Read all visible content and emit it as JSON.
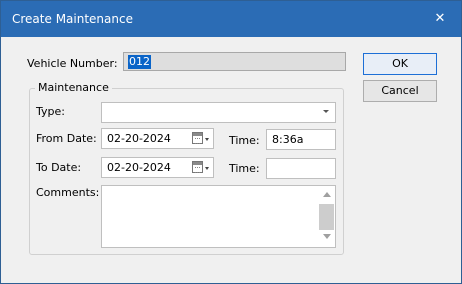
{
  "window": {
    "title": "Create Maintenance",
    "close_glyph": "✕"
  },
  "vehicle": {
    "label": "Vehicle Number:",
    "value": "012"
  },
  "buttons": {
    "ok": "OK",
    "cancel": "Cancel"
  },
  "maintenance": {
    "caption": "Maintenance",
    "type_label": "Type:",
    "type_value": "",
    "from_date_label": "From Date:",
    "from_date_value": "02-20-2024",
    "from_time_label": "Time:",
    "from_time_value": "8:36a",
    "to_date_label": "To Date:",
    "to_date_value": "02-20-2024",
    "to_time_label": "Time:",
    "to_time_value": "",
    "comments_label": "Comments:",
    "comments_value": ""
  },
  "icons": {
    "close": "close-icon",
    "dropdown": "chevron-down-icon",
    "calendar": "calendar-icon"
  },
  "colors": {
    "titlebar": "#2b6cb5",
    "selection": "#0a64c8",
    "default_button_border": "#1d6fd6"
  }
}
